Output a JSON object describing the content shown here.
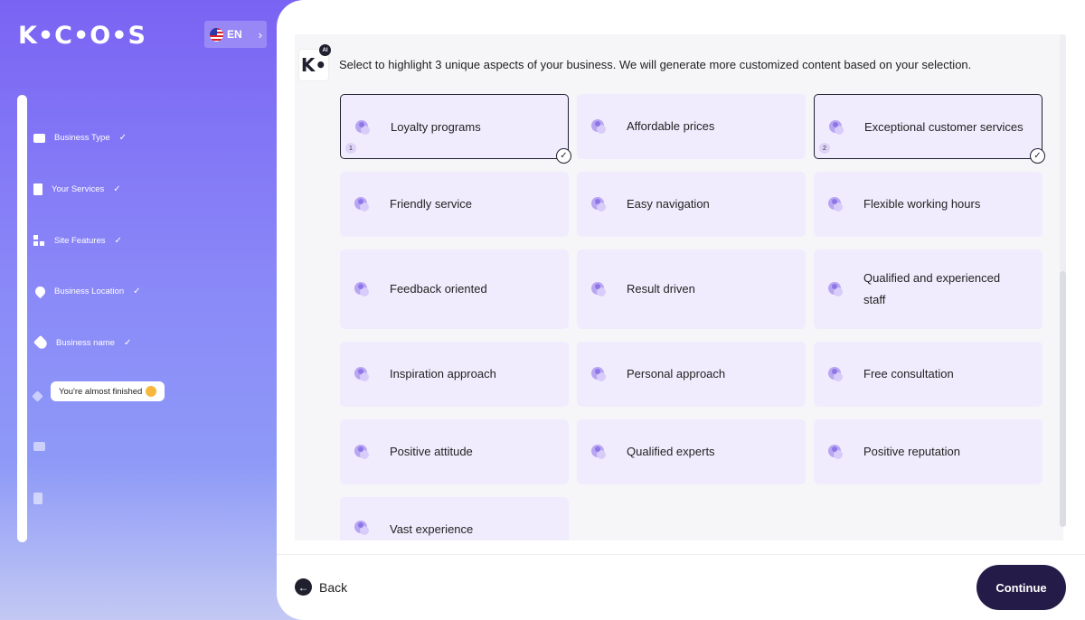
{
  "brand": {
    "logo_text": "K•C•O•S"
  },
  "language": {
    "code": "EN",
    "flag": "us-flag-icon",
    "chevron": "›"
  },
  "steps": [
    {
      "label": "Business Type",
      "check": "✓",
      "icon": "briefcase-icon",
      "status": "done"
    },
    {
      "label": "Your Services",
      "check": "✓",
      "icon": "document-icon",
      "status": "done"
    },
    {
      "label": "Site Features",
      "check": "✓",
      "icon": "grid-plus-icon",
      "status": "done"
    },
    {
      "label": "Business Location",
      "check": "✓",
      "icon": "location-pin-icon",
      "status": "done"
    },
    {
      "label": "Business name",
      "check": "✓",
      "icon": "tag-icon",
      "status": "done"
    },
    {
      "label": "",
      "icon": "diamond-icon",
      "status": "current"
    },
    {
      "label": "",
      "icon": "mail-icon",
      "status": "pending"
    },
    {
      "label": "",
      "icon": "page-icon",
      "status": "pending"
    }
  ],
  "tooltip": {
    "text": "You're almost finished",
    "emoji": "party-face-emoji"
  },
  "assistant": {
    "badge": "AI",
    "logo": "K•"
  },
  "prompt": "Select to highlight 3 unique aspects of your business. We will generate more customized content based on your selection.",
  "aspects": [
    {
      "label": "Loyalty programs",
      "selected": true,
      "order": "1",
      "icon": "loyalty-card-icon"
    },
    {
      "label": "Affordable prices",
      "selected": false,
      "icon": "coins-icon"
    },
    {
      "label": "Exceptional customer services",
      "selected": true,
      "order": "2",
      "icon": "customer-service-icon"
    },
    {
      "label": "Friendly service",
      "selected": false,
      "icon": "friendly-heart-icon"
    },
    {
      "label": "Easy navigation",
      "selected": false,
      "icon": "map-icon"
    },
    {
      "label": "Flexible working hours",
      "selected": false,
      "icon": "clock-gear-icon"
    },
    {
      "label": "Feedback oriented",
      "selected": false,
      "icon": "feedback-icon"
    },
    {
      "label": "Result driven",
      "selected": false,
      "icon": "target-icon"
    },
    {
      "label": "Qualified and experienced staff",
      "selected": false,
      "icon": "staff-icon"
    },
    {
      "label": "Inspiration approach",
      "selected": false,
      "icon": "lightbulb-icon"
    },
    {
      "label": "Personal approach",
      "selected": false,
      "icon": "person-icon"
    },
    {
      "label": "Free consultation",
      "selected": false,
      "icon": "consultation-icon"
    },
    {
      "label": "Positive attitude",
      "selected": false,
      "icon": "smile-icon"
    },
    {
      "label": "Qualified experts",
      "selected": false,
      "icon": "expert-icon"
    },
    {
      "label": "Positive reputation",
      "selected": false,
      "icon": "award-ribbon-icon"
    },
    {
      "label": "Vast experience",
      "selected": false,
      "icon": "briefcase-icon"
    }
  ],
  "footer": {
    "back_label": "Back",
    "continue_label": "Continue"
  },
  "colors": {
    "accent_dark": "#241b48",
    "card_bg": "#f1ecfd",
    "icon_purple": "#a58ef0",
    "sidebar_top": "#7a63f3"
  }
}
